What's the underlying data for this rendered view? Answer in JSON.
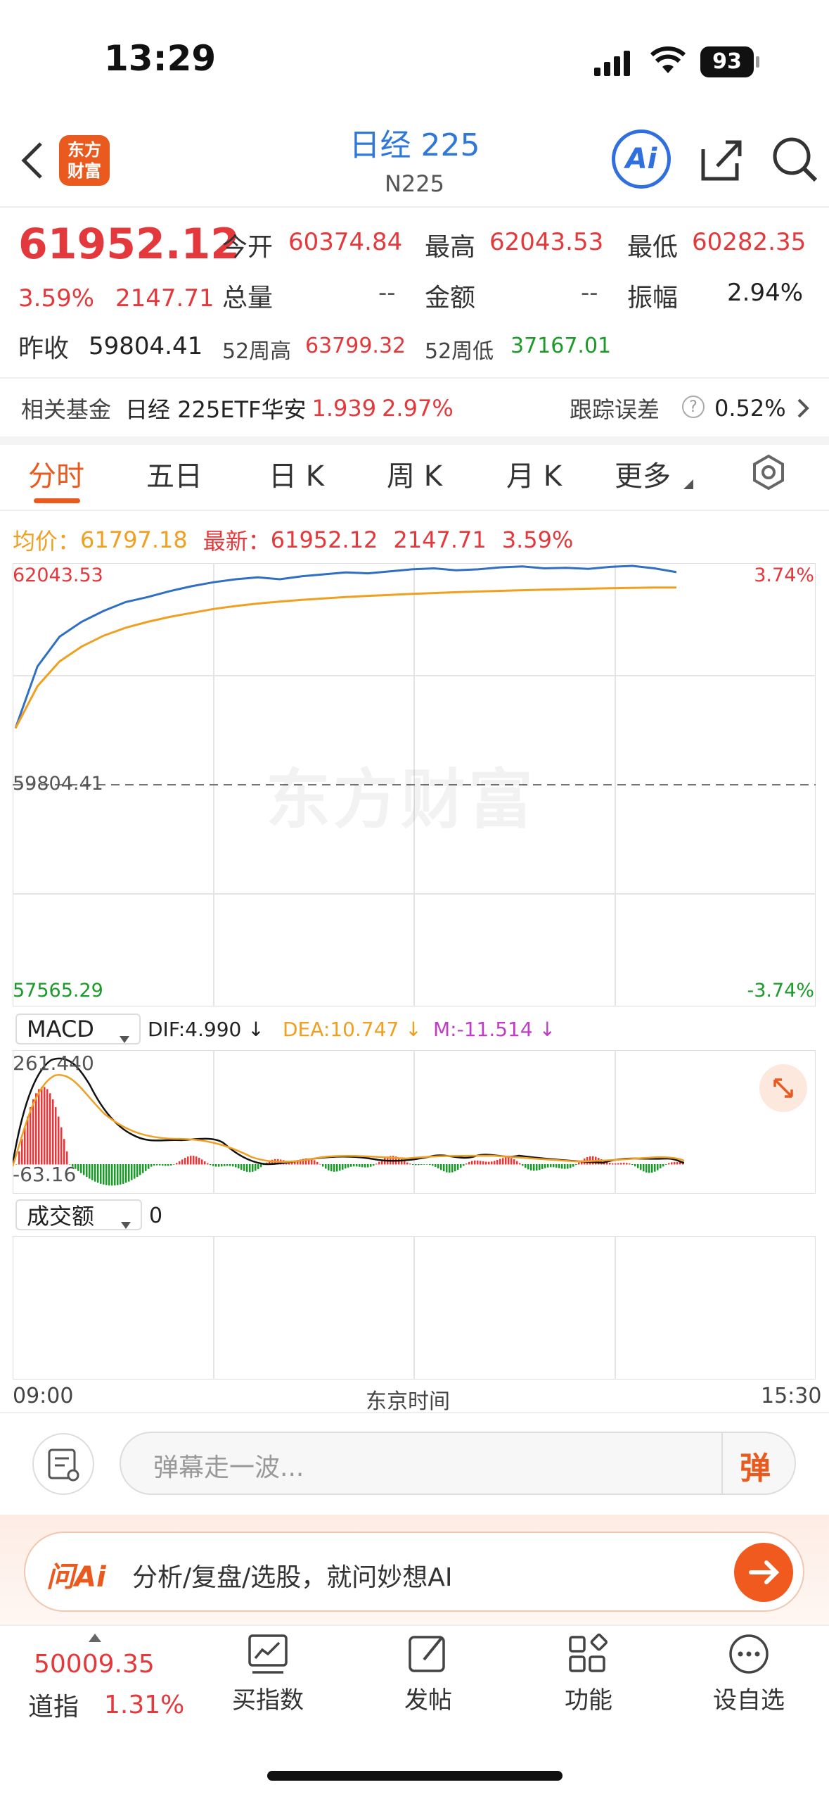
{
  "status": {
    "time": "13:29",
    "battery": "93"
  },
  "header": {
    "logo_line1": "东方",
    "logo_line2": "财富",
    "title": "日经 225",
    "code": "N225",
    "ai_label": "Ai"
  },
  "quote": {
    "price": "61952.12",
    "pct": "3.59%",
    "change": "2147.71",
    "open_label": "今开",
    "open": "60374.84",
    "high_label": "最高",
    "high": "62043.53",
    "low_label": "最低",
    "low": "60282.35",
    "volume_label": "总量",
    "volume": "--",
    "amount_label": "金额",
    "amount": "--",
    "amplitude_label": "振幅",
    "amplitude": "2.94%",
    "prev_close_label": "昨收",
    "prev_close": "59804.41",
    "wk52_high_label": "52周高",
    "wk52_high": "63799.32",
    "wk52_low_label": "52周低",
    "wk52_low": "37167.01"
  },
  "fund": {
    "label": "相关基金",
    "name": "日经 225ETF华安",
    "price": "1.939",
    "pct": "2.97%",
    "tracking_label": "跟踪误差",
    "tracking_value": "0.52%"
  },
  "tabs": [
    "分时",
    "五日",
    "日 K",
    "周 K",
    "月 K",
    "更多"
  ],
  "legend": {
    "avg_label": "均价：",
    "avg_value": "61797.18",
    "latest_label": "最新：",
    "latest_value": "61952.12",
    "latest_change": "2147.71",
    "latest_pct": "3.59%"
  },
  "chart_axes": {
    "top_value": "62043.53",
    "mid_value": "59804.41",
    "bottom_value": "57565.29",
    "top_pct": "3.74%",
    "bottom_pct": "-3.74%",
    "watermark": "东方财富",
    "time_start": "09:00",
    "time_mid": "东京时间",
    "time_end": "15:30"
  },
  "macd": {
    "selector": "MACD",
    "dif": "DIF:4.990 ↓",
    "dea": "DEA:10.747 ↓",
    "m": "M:-11.514 ↓",
    "top_value": "261.440",
    "bottom_value": "-63.16"
  },
  "volume_panel": {
    "selector": "成交额",
    "value": "0"
  },
  "comment": {
    "placeholder": "弹幕走一波...",
    "danmu_label": "弹"
  },
  "ai_bar": {
    "logo": "问Ai",
    "text": "分析/复盘/选股，就问妙想AI"
  },
  "bottom": {
    "dow_value": "50009.35",
    "dow_name": "道指",
    "dow_pct": "1.31%",
    "items": [
      "买指数",
      "发帖",
      "功能",
      "设自选"
    ]
  },
  "colors": {
    "up": "#e4393c",
    "down": "#1a9b2a",
    "price_line": "#2f6fc4",
    "avg_line": "#f0a020",
    "accent": "#ea5a1f"
  },
  "chart_data": {
    "type": "line",
    "x_range": [
      "09:00",
      "15:30"
    ],
    "ylim": [
      57565.29,
      62043.53
    ],
    "reference": 59804.41,
    "series": [
      {
        "name": "最新",
        "color": "#2f6fc4",
        "values": [
          60374.84,
          61000,
          61300,
          61450,
          61560,
          61650,
          61700,
          61760,
          61810,
          61850,
          61880,
          61900,
          61880,
          61910,
          61930,
          61950,
          61940,
          61960,
          61980,
          61990,
          61970,
          61980,
          62000,
          62010,
          61990,
          61995,
          61985,
          62005,
          62015,
          61990,
          61952.12
        ]
      },
      {
        "name": "均价",
        "color": "#f0a020",
        "values": [
          60374.84,
          60800,
          61050,
          61200,
          61310,
          61390,
          61450,
          61500,
          61540,
          61580,
          61610,
          61635,
          61655,
          61672,
          61687,
          61700,
          61712,
          61722,
          61732,
          61741,
          61749,
          61756,
          61763,
          61769,
          61775,
          61780,
          61785,
          61789,
          61793,
          61796,
          61797.18
        ]
      }
    ]
  }
}
